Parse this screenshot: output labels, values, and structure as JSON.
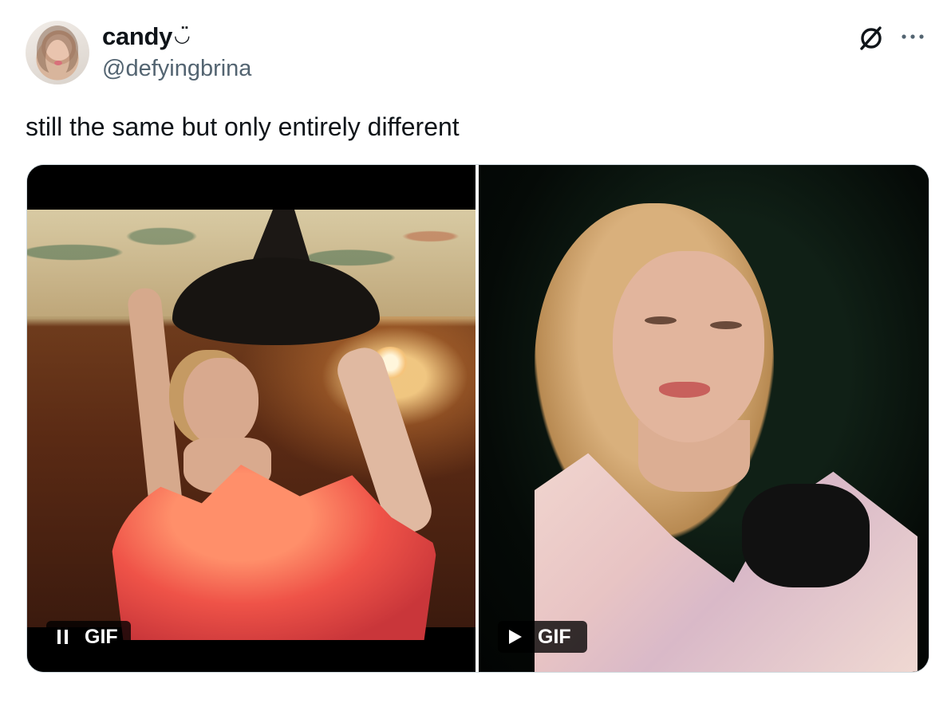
{
  "author": {
    "display_name": "candy",
    "name_emoji": "◡̈",
    "handle": "@defyingbrina",
    "avatar_icon": "avatar-photo"
  },
  "header_icons": {
    "grok": "grok-icon",
    "more": "more-options-icon"
  },
  "tweet": {
    "text": "still the same but only entirely different"
  },
  "media": {
    "items": [
      {
        "type": "gif",
        "badge_label": "GIF",
        "control": "pause",
        "control_icon": "pause-icon"
      },
      {
        "type": "gif",
        "badge_label": "GIF",
        "control": "play",
        "control_icon": "play-icon"
      }
    ]
  },
  "colors": {
    "text_primary": "#0f1419",
    "text_secondary": "#536471",
    "media_border": "#cfd9de"
  }
}
